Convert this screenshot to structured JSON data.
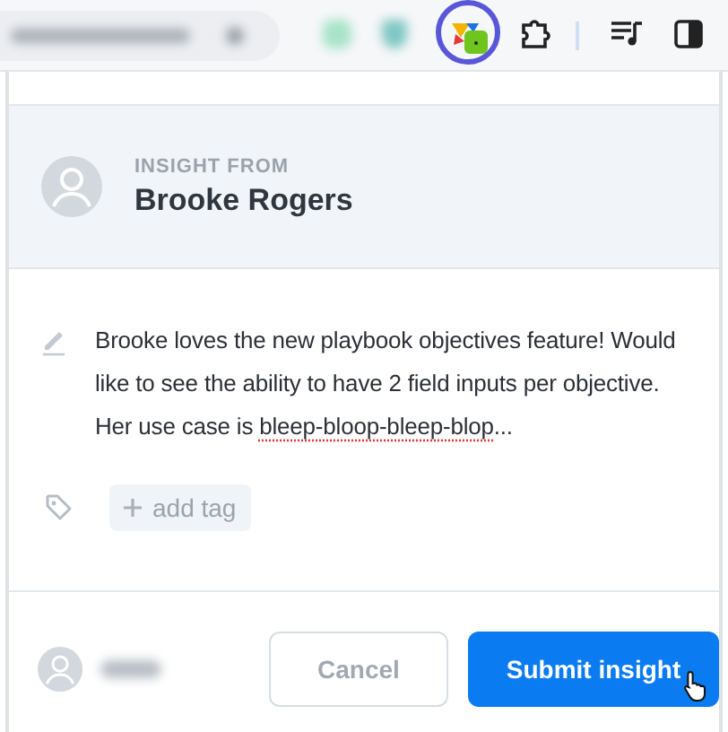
{
  "toolbar": {
    "extension_highlighted": true
  },
  "insight": {
    "from_label": "INSIGHT FROM",
    "name": "Brooke Rogers"
  },
  "note": {
    "segments": [
      {
        "text": "Brooke loves the new playbook objectives feature! Would like to see the ability to have 2 field inputs per objective. Her use case is ",
        "misspelled": false
      },
      {
        "text": "bleep-bloop-bleep-blop",
        "misspelled": true
      },
      {
        "text": "...",
        "misspelled": false
      }
    ]
  },
  "tags": {
    "add_label": "add tag"
  },
  "buttons": [
    {
      "label": "Cancel",
      "kind": "secondary"
    },
    {
      "label": "Submit insight",
      "kind": "primary"
    }
  ]
}
